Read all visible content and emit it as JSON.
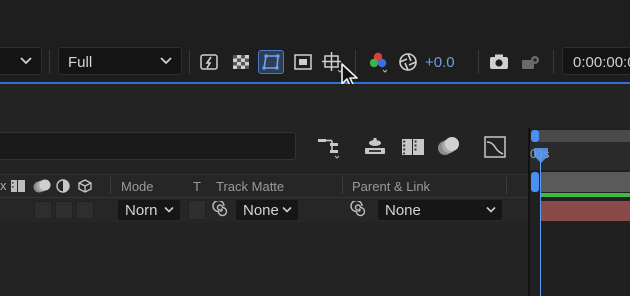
{
  "toolbar": {
    "resolution": {
      "value": "Full",
      "icon": "chevron-down-icon"
    },
    "left_dropdown": {
      "icon": "chevron-down-icon"
    },
    "exposure_value": "+0.0",
    "timecode": "0:00:00:0",
    "buttons": [
      "fast-previews-icon",
      "transparency-grid-icon",
      "mask-path-visibility-icon",
      "region-of-interest-icon",
      "title-action-safe-icon",
      "show-channel-icon",
      "reset-exposure-icon",
      "snapshot-camera-icon",
      "show-snapshot-icon"
    ],
    "colors": {
      "accent": "#2f6fd6",
      "active_bg": "#2d3d55",
      "exposure_text": "#6f9fe0"
    }
  },
  "timeline": {
    "ruler_label": "00s",
    "columns": {
      "mode": "Mode",
      "t": "T",
      "track_matte": "Track Matte",
      "parent_link": "Parent & Link"
    },
    "layer": {
      "mode_value": "Norn",
      "track_matte_value": "None",
      "parent_value": "None"
    },
    "tool_icons": [
      "flowchart-icon",
      "draft-3d-icon",
      "frame-blending-icon",
      "motion-blur-icon",
      "graph-editor-icon"
    ],
    "colors": {
      "layer_bar": "#8a4a4a",
      "playhead": "#5b9cf5",
      "green_bar": "#3dbb3d"
    }
  }
}
